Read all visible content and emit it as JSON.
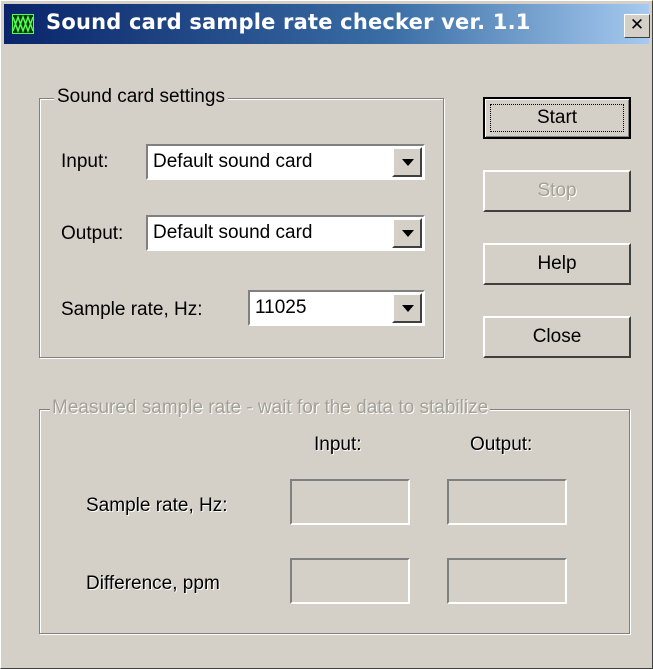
{
  "window": {
    "title": "Sound card sample rate checker ver. 1.1",
    "close_glyph": "✕",
    "icon": "app-waveform-icon"
  },
  "settings": {
    "legend": "Sound card settings",
    "input_label": "Input:",
    "input_value": "Default sound card",
    "output_label": "Output:",
    "output_value": "Default sound card",
    "rate_label": "Sample rate, Hz:",
    "rate_value": "11025"
  },
  "buttons": {
    "start": "Start",
    "stop": "Stop",
    "help": "Help",
    "close": "Close"
  },
  "measured": {
    "legend": "Measured sample rate - wait for the data to stabilize",
    "col_input": "Input:",
    "col_output": "Output:",
    "rate_label": "Sample rate, Hz:",
    "diff_label": "Difference, ppm",
    "rate_input": "",
    "rate_output": "",
    "diff_input": "",
    "diff_output": ""
  },
  "colors": {
    "face": "#d4d0c8",
    "title_start": "#0a246a",
    "title_end": "#a6caf0",
    "disabled_text": "#a3a096"
  }
}
